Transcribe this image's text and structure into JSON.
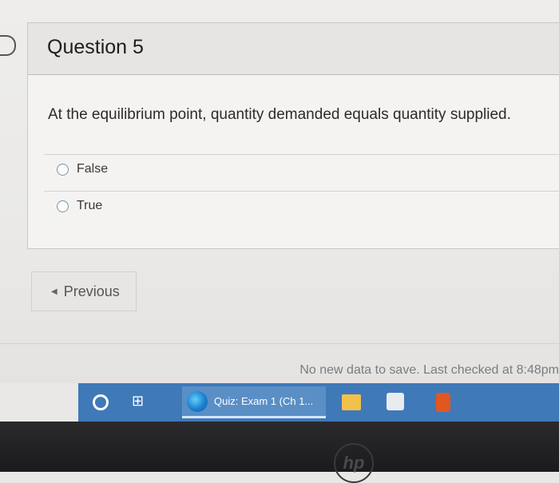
{
  "question": {
    "title": "Question 5",
    "text": "At the equilibrium point, quantity demanded equals quantity supplied.",
    "options": [
      {
        "label": "False",
        "selected": false
      },
      {
        "label": "True",
        "selected": false
      }
    ]
  },
  "navigation": {
    "previous_label": "Previous",
    "previous_icon": "chevron-left-icon"
  },
  "status": {
    "text": "No new data to save. Last checked at 8:48pm"
  },
  "taskbar": {
    "active_app_label": "Quiz: Exam 1 (Ch 1...",
    "icons": [
      "cortana-icon",
      "task-view-icon",
      "edge-icon",
      "file-explorer-icon",
      "store-icon",
      "office-icon"
    ]
  },
  "device": {
    "logo_text": "hp"
  },
  "colors": {
    "taskbar": "#3f79b8",
    "radio_border": "#7a93a8"
  }
}
